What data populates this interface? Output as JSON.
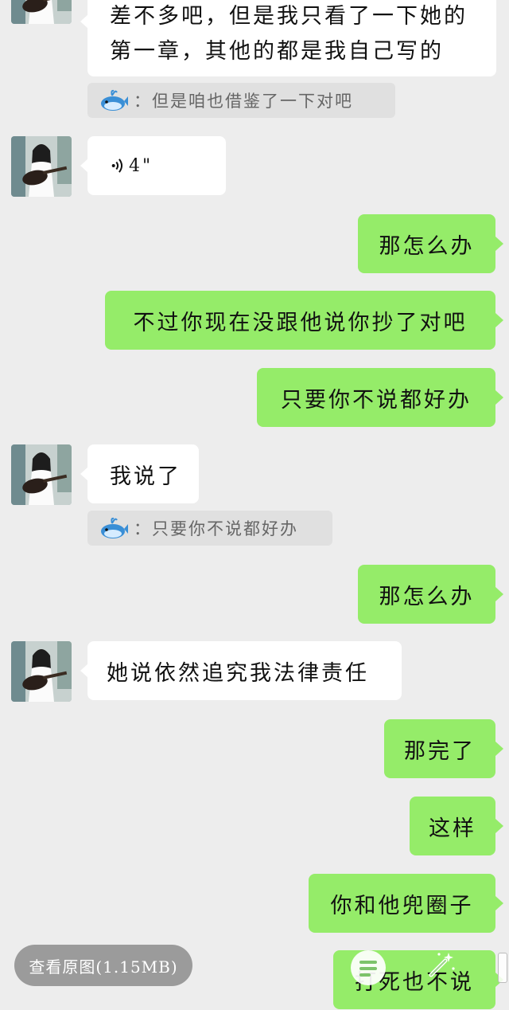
{
  "messages": {
    "m1_line1": "差不多吧，但是我只看了一下她的",
    "m1_line2": "第一章，其他的都是我自己写的",
    "m1_quote": "：但是咱也借鉴了一下对吧",
    "m2_voice": "4\"",
    "m3": "那怎么办",
    "m4": "不过你现在没跟他说你抄了对吧",
    "m5": "只要你不说都好办",
    "m6": "我说了",
    "m6_quote": "：只要你不说都好办",
    "m7": "那怎么办",
    "m8": "她说依然追究我法律责任",
    "m9": "那完了",
    "m10": "这样",
    "m11": "你和他兜圈子",
    "m12": "打死也不说"
  },
  "overlay": {
    "view_original": "查看原图(1.15MB)"
  },
  "colors": {
    "background": "#ededed",
    "incoming_bubble": "#ffffff",
    "outgoing_bubble": "#95ec69",
    "quote_bg": "#e0e0e0"
  }
}
